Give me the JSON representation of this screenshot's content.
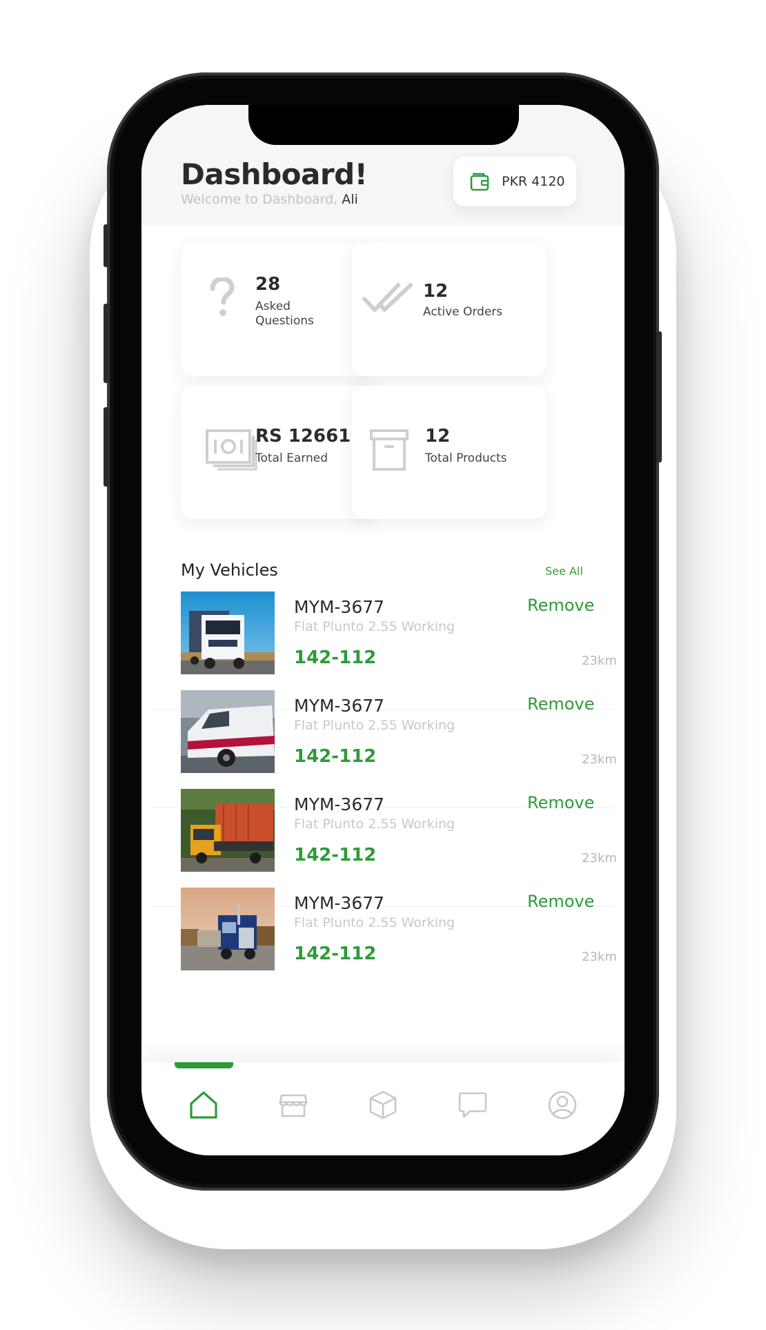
{
  "header": {
    "title": "Dashboard!",
    "welcome": "Welcome to Dashboard,",
    "username": "Ali",
    "wallet_amount": "PKR 4120"
  },
  "stats": [
    {
      "icon": "question-icon",
      "value": "28",
      "label": "Asked Questions"
    },
    {
      "icon": "double-check-icon",
      "value": "12",
      "label": "Active Orders"
    },
    {
      "icon": "cash-stack-icon",
      "value": "RS 12661",
      "label": "Total Earned"
    },
    {
      "icon": "archive-box-icon",
      "value": "12",
      "label": "Total Products"
    }
  ],
  "vehicles": {
    "title": "My Vehicles",
    "see_all": "See All",
    "items": [
      {
        "plate": "MYM-3677",
        "desc": "Flat Plunto 2.55 Working",
        "number": "142-112",
        "action": "Remove",
        "distance": "23km",
        "image": "white-truck-photo"
      },
      {
        "plate": "MYM-3677",
        "desc": "Flat Plunto 2.55 Working",
        "number": "142-112",
        "action": "Remove",
        "distance": "23km",
        "image": "white-van-photo"
      },
      {
        "plate": "MYM-3677",
        "desc": "Flat Plunto 2.55 Working",
        "number": "142-112",
        "action": "Remove",
        "distance": "23km",
        "image": "container-truck-photo"
      },
      {
        "plate": "MYM-3677",
        "desc": "Flat Plunto 2.55 Working",
        "number": "142-112",
        "action": "Remove",
        "distance": "23km",
        "image": "blue-semi-truck-photo"
      }
    ]
  },
  "bottom_nav": [
    {
      "icon": "home-icon",
      "active": true
    },
    {
      "icon": "store-icon",
      "active": false
    },
    {
      "icon": "box-icon",
      "active": false
    },
    {
      "icon": "chat-icon",
      "active": false
    },
    {
      "icon": "profile-icon",
      "active": false
    }
  ],
  "colors": {
    "accent": "#2e9b3a",
    "muted": "#c8c8c8",
    "text": "#2a2a2a"
  }
}
